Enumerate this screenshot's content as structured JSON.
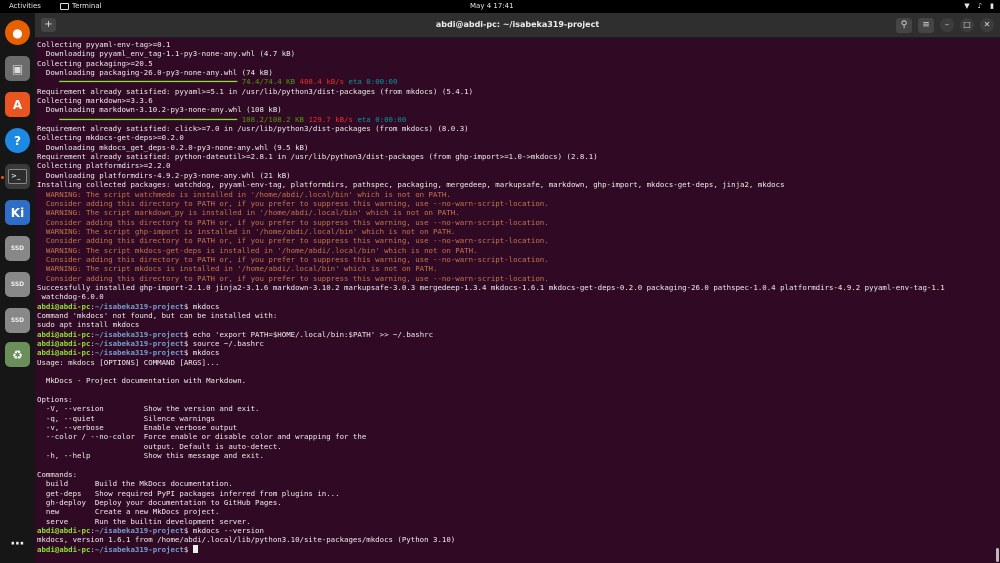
{
  "topbar": {
    "activities": "Activities",
    "app_name": "Terminal",
    "clock": "May 4  17:41"
  },
  "window": {
    "title": "abdi@abdi-pc: ~/isabeka319-project"
  },
  "dock": {
    "items": [
      "firefox",
      "files",
      "app-center",
      "help",
      "terminal",
      "kiro",
      "ssd",
      "ssd",
      "ssd",
      "trash",
      "show-apps"
    ]
  },
  "prompt": {
    "user": "abdi@abdi-pc",
    "path": "~/isabeka319-project"
  },
  "terminal": [
    {
      "t": "Collecting pyyaml-env-tag>=0.1"
    },
    {
      "t": "  Downloading pyyaml_env_tag-1.1-py3-none-any.whl (4.7 kB)"
    },
    {
      "t": "Collecting packaging>=20.5"
    },
    {
      "t": "  Downloading packaging-26.0-py3-none-any.whl (74 kB)"
    },
    {
      "progress": true,
      "pct": "74.4/74.4 KB",
      "rate": "408.4 kB/s",
      "eta": "eta 0:00:00"
    },
    {
      "t": "Requirement already satisfied: pyyaml>=5.1 in /usr/lib/python3/dist-packages (from mkdocs) (5.4.1)"
    },
    {
      "t": "Collecting markdown>=3.3.6"
    },
    {
      "t": "  Downloading markdown-3.10.2-py3-none-any.whl (108 kB)"
    },
    {
      "progress": true,
      "pct": "108.2/108.2 KB",
      "rate": "129.7 kB/s",
      "eta": "eta 0:00:00"
    },
    {
      "t": "Requirement already satisfied: click>=7.0 in /usr/lib/python3/dist-packages (from mkdocs) (8.0.3)"
    },
    {
      "t": "Collecting mkdocs-get-deps>=0.2.0"
    },
    {
      "t": "  Downloading mkdocs_get_deps-0.2.0-py3-none-any.whl (9.5 kB)"
    },
    {
      "t": "Requirement already satisfied: python-dateutil>=2.8.1 in /usr/lib/python3/dist-packages (from ghp-import>=1.0->mkdocs) (2.8.1)"
    },
    {
      "t": "Collecting platformdirs>=2.2.0"
    },
    {
      "t": "  Downloading platformdirs-4.9.2-py3-none-any.whl (21 kB)"
    },
    {
      "t": "Installing collected packages: watchdog, pyyaml-env-tag, platformdirs, pathspec, packaging, mergedeep, markupsafe, markdown, ghp-import, mkdocs-get-deps, jinja2, mkdocs"
    },
    {
      "t": "  WARNING: The script watchmedo is installed in '/home/abdi/.local/bin' which is not on PATH.",
      "c": "warn"
    },
    {
      "t": "  Consider adding this directory to PATH or, if you prefer to suppress this warning, use --no-warn-script-location.",
      "c": "warn"
    },
    {
      "t": "  WARNING: The script markdown_py is installed in '/home/abdi/.local/bin' which is not on PATH.",
      "c": "warn"
    },
    {
      "t": "  Consider adding this directory to PATH or, if you prefer to suppress this warning, use --no-warn-script-location.",
      "c": "warn"
    },
    {
      "t": "  WARNING: The script ghp-import is installed in '/home/abdi/.local/bin' which is not on PATH.",
      "c": "warn"
    },
    {
      "t": "  Consider adding this directory to PATH or, if you prefer to suppress this warning, use --no-warn-script-location.",
      "c": "warn"
    },
    {
      "t": "  WARNING: The script mkdocs-get-deps is installed in '/home/abdi/.local/bin' which is not on PATH.",
      "c": "warn"
    },
    {
      "t": "  Consider adding this directory to PATH or, if you prefer to suppress this warning, use --no-warn-script-location.",
      "c": "warn"
    },
    {
      "t": "  WARNING: The script mkdocs is installed in '/home/abdi/.local/bin' which is not on PATH.",
      "c": "warn"
    },
    {
      "t": "  Consider adding this directory to PATH or, if you prefer to suppress this warning, use --no-warn-script-location.",
      "c": "warn"
    },
    {
      "t": "Successfully installed ghp-import-2.1.0 jinja2-3.1.6 markdown-3.10.2 markupsafe-3.0.3 mergedeep-1.3.4 mkdocs-1.6.1 mkdocs-get-deps-0.2.0 packaging-26.0 pathspec-1.0.4 platformdirs-4.9.2 pyyaml-env-tag-1.1"
    },
    {
      "t": " watchdog-6.0.0"
    },
    {
      "cmd": " mkdocs"
    },
    {
      "t": "Command 'mkdocs' not found, but can be installed with:"
    },
    {
      "t": "sudo apt install mkdocs"
    },
    {
      "cmd": " echo 'export PATH=$HOME/.local/bin:$PATH' >> ~/.bashrc"
    },
    {
      "cmd": " source ~/.bashrc"
    },
    {
      "cmd": " mkdocs"
    },
    {
      "t": "Usage: mkdocs [OPTIONS] COMMAND [ARGS]..."
    },
    {
      "t": ""
    },
    {
      "t": "  MkDocs - Project documentation with Markdown."
    },
    {
      "t": ""
    },
    {
      "t": "Options:"
    },
    {
      "t": "  -V, --version         Show the version and exit."
    },
    {
      "t": "  -q, --quiet           Silence warnings"
    },
    {
      "t": "  -v, --verbose         Enable verbose output"
    },
    {
      "t": "  --color / --no-color  Force enable or disable color and wrapping for the"
    },
    {
      "t": "                        output. Default is auto-detect."
    },
    {
      "t": "  -h, --help            Show this message and exit."
    },
    {
      "t": ""
    },
    {
      "t": "Commands:"
    },
    {
      "t": "  build      Build the MkDocs documentation."
    },
    {
      "t": "  get-deps   Show required PyPI packages inferred from plugins in..."
    },
    {
      "t": "  gh-deploy  Deploy your documentation to GitHub Pages."
    },
    {
      "t": "  new        Create a new MkDocs project."
    },
    {
      "t": "  serve      Run the builtin development server."
    },
    {
      "cmd": " mkdocs --version"
    },
    {
      "t": "mkdocs, version 1.6.1 from /home/abdi/.local/lib/python3.10/site-packages/mkdocs (Python 3.10)"
    },
    {
      "cmd": " ",
      "cursor": true
    }
  ]
}
